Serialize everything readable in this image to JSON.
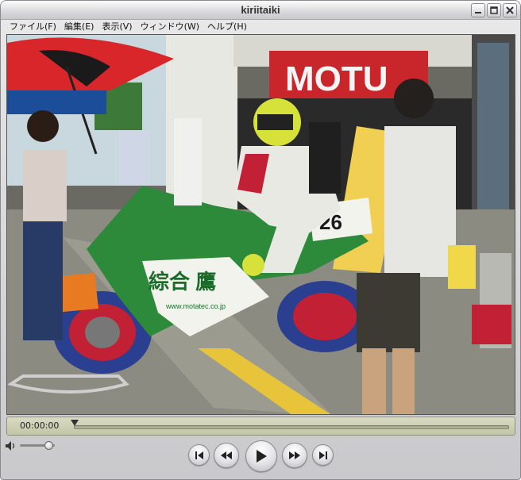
{
  "window": {
    "title": "kiriitaiki"
  },
  "menu": {
    "items": [
      "ファイル(F)",
      "編集(E)",
      "表示(V)",
      "ウィンドウ(W)",
      "ヘルプ(H)"
    ]
  },
  "video": {
    "description_signs": {
      "motul": "MOTU",
      "bike_number": "26",
      "truck_text": "www.motatec.co.jp"
    }
  },
  "timeline": {
    "current_time": "00:00:00",
    "progress": 0.0
  },
  "volume": {
    "level": 0.82
  },
  "transport": {
    "buttons": [
      "go-to-start",
      "rewind",
      "play",
      "fast-forward",
      "go-to-end"
    ]
  },
  "colors": {
    "accent": "#c3c6a6",
    "chrome": "#c9c9cc"
  }
}
